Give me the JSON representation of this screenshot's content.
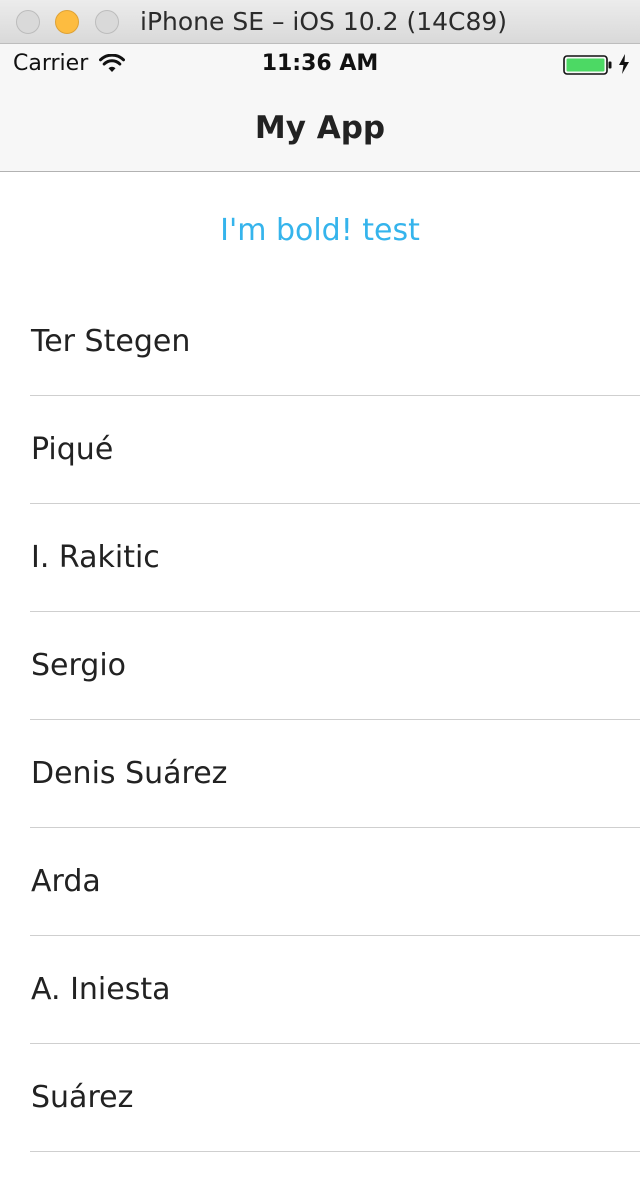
{
  "window": {
    "title": "iPhone SE – iOS 10.2 (14C89)"
  },
  "status_bar": {
    "carrier": "Carrier",
    "time": "11:36 AM",
    "battery_color": "#4cd964"
  },
  "nav_bar": {
    "title": "My App"
  },
  "content": {
    "bold_text": "I'm bold! test",
    "bold_text_color": "#35b4ec",
    "players": [
      "Ter Stegen",
      "Piqué",
      "I. Rakitic",
      "Sergio",
      "Denis Suárez",
      "Arda",
      "A. Iniesta",
      "Suárez"
    ]
  }
}
